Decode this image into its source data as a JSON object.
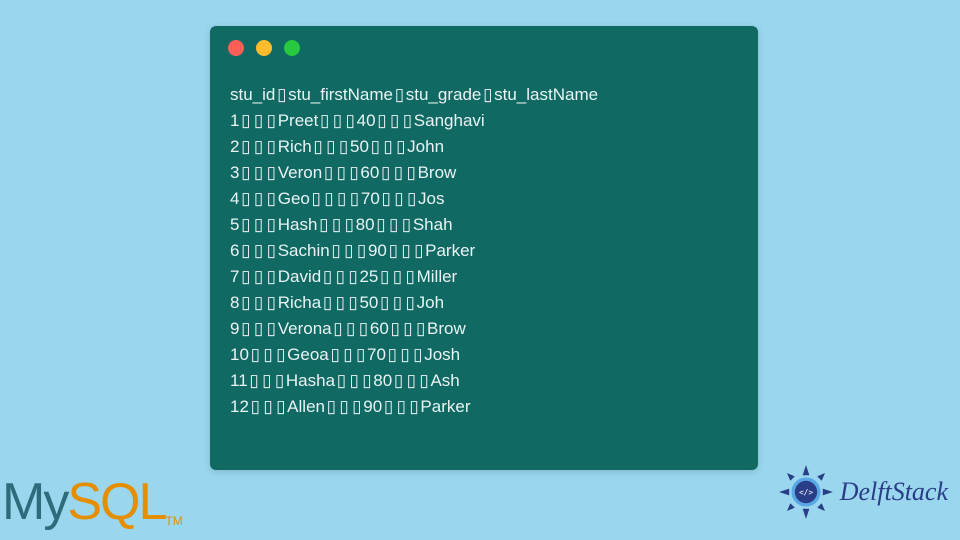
{
  "terminal": {
    "header_row": [
      "stu_id",
      "stu_firstName",
      "stu_grade",
      "stu_lastName"
    ],
    "header_separators": [
      1,
      1,
      1
    ],
    "rows": [
      {
        "stu_id": "1",
        "stu_firstName": "Preet",
        "stu_grade": "40",
        "stu_lastName": "Sanghavi",
        "sep": [
          3,
          3,
          3
        ]
      },
      {
        "stu_id": "2",
        "stu_firstName": "Rich",
        "stu_grade": "50",
        "stu_lastName": "John",
        "sep": [
          3,
          3,
          3
        ]
      },
      {
        "stu_id": "3",
        "stu_firstName": "Veron",
        "stu_grade": "60",
        "stu_lastName": "Brow",
        "sep": [
          3,
          3,
          3
        ]
      },
      {
        "stu_id": "4",
        "stu_firstName": "Geo",
        "stu_grade": "70",
        "stu_lastName": "Jos",
        "sep": [
          3,
          4,
          3
        ]
      },
      {
        "stu_id": "5",
        "stu_firstName": "Hash",
        "stu_grade": "80",
        "stu_lastName": "Shah",
        "sep": [
          3,
          3,
          3
        ]
      },
      {
        "stu_id": "6",
        "stu_firstName": "Sachin",
        "stu_grade": "90",
        "stu_lastName": "Parker",
        "sep": [
          3,
          3,
          3
        ]
      },
      {
        "stu_id": "7",
        "stu_firstName": "David",
        "stu_grade": "25",
        "stu_lastName": "Miller",
        "sep": [
          3,
          3,
          3
        ]
      },
      {
        "stu_id": "8",
        "stu_firstName": "Richa",
        "stu_grade": "50",
        "stu_lastName": "Joh",
        "sep": [
          3,
          3,
          3
        ]
      },
      {
        "stu_id": "9",
        "stu_firstName": "Verona",
        "stu_grade": "60",
        "stu_lastName": "Brow",
        "sep": [
          3,
          3,
          3
        ]
      },
      {
        "stu_id": "10",
        "stu_firstName": "Geoa",
        "stu_grade": "70",
        "stu_lastName": "Josh",
        "sep": [
          3,
          3,
          3
        ]
      },
      {
        "stu_id": "11",
        "stu_firstName": "Hasha",
        "stu_grade": "80",
        "stu_lastName": "Ash",
        "sep": [
          3,
          3,
          3
        ]
      },
      {
        "stu_id": "12",
        "stu_firstName": "Allen",
        "stu_grade": "90",
        "stu_lastName": "Parker",
        "sep": [
          3,
          3,
          3
        ]
      }
    ]
  },
  "logos": {
    "mysql_my": "My",
    "mysql_sql": "SQL",
    "mysql_tm": "TM",
    "delftstack": "DelftStack"
  },
  "colors": {
    "page_bg": "#9ad7ef",
    "terminal_bg": "#116964",
    "terminal_fg": "#e8f4f3",
    "dot_red": "#ff5f56",
    "dot_yellow": "#ffbd2e",
    "dot_green": "#27c93f",
    "mysql_blue": "#2f6b7a",
    "mysql_orange": "#e48e00",
    "delft_blue": "#2a3d87"
  },
  "glyph": "▯"
}
